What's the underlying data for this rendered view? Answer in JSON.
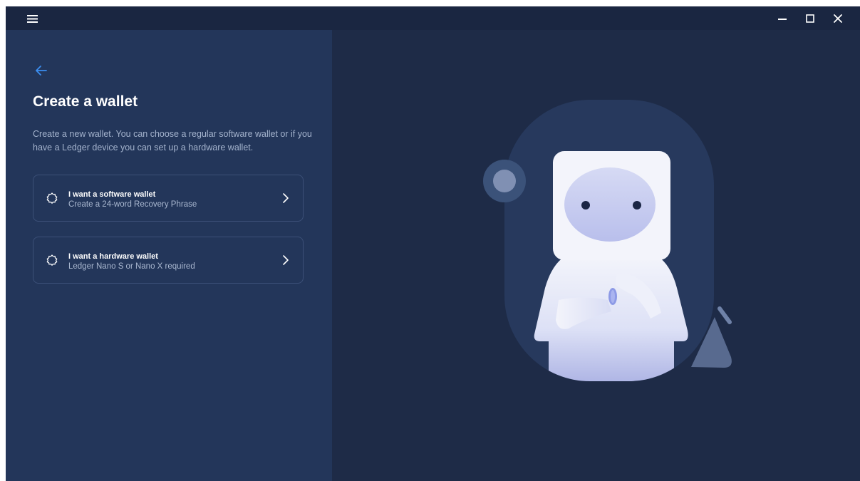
{
  "icons": {
    "menu": "hamburger-menu-icon",
    "minimize": "minimize-icon",
    "maximize": "maximize-icon",
    "close": "close-icon",
    "back": "back-arrow-icon",
    "option": "gear-icon",
    "chevron": "chevron-right-icon"
  },
  "colors": {
    "background": "#1e2b47",
    "panel": "#23365a",
    "accent": "#3b8ef0"
  },
  "page": {
    "title": "Create a wallet",
    "description": "Create a new wallet. You can choose a regular software wallet or if you have a Ledger device you can set up a hardware wallet."
  },
  "options": [
    {
      "title": "I want a software wallet",
      "subtitle": "Create a 24-word Recovery Phrase"
    },
    {
      "title": "I want a hardware wallet",
      "subtitle": "Ledger Nano S or Nano X required"
    }
  ]
}
